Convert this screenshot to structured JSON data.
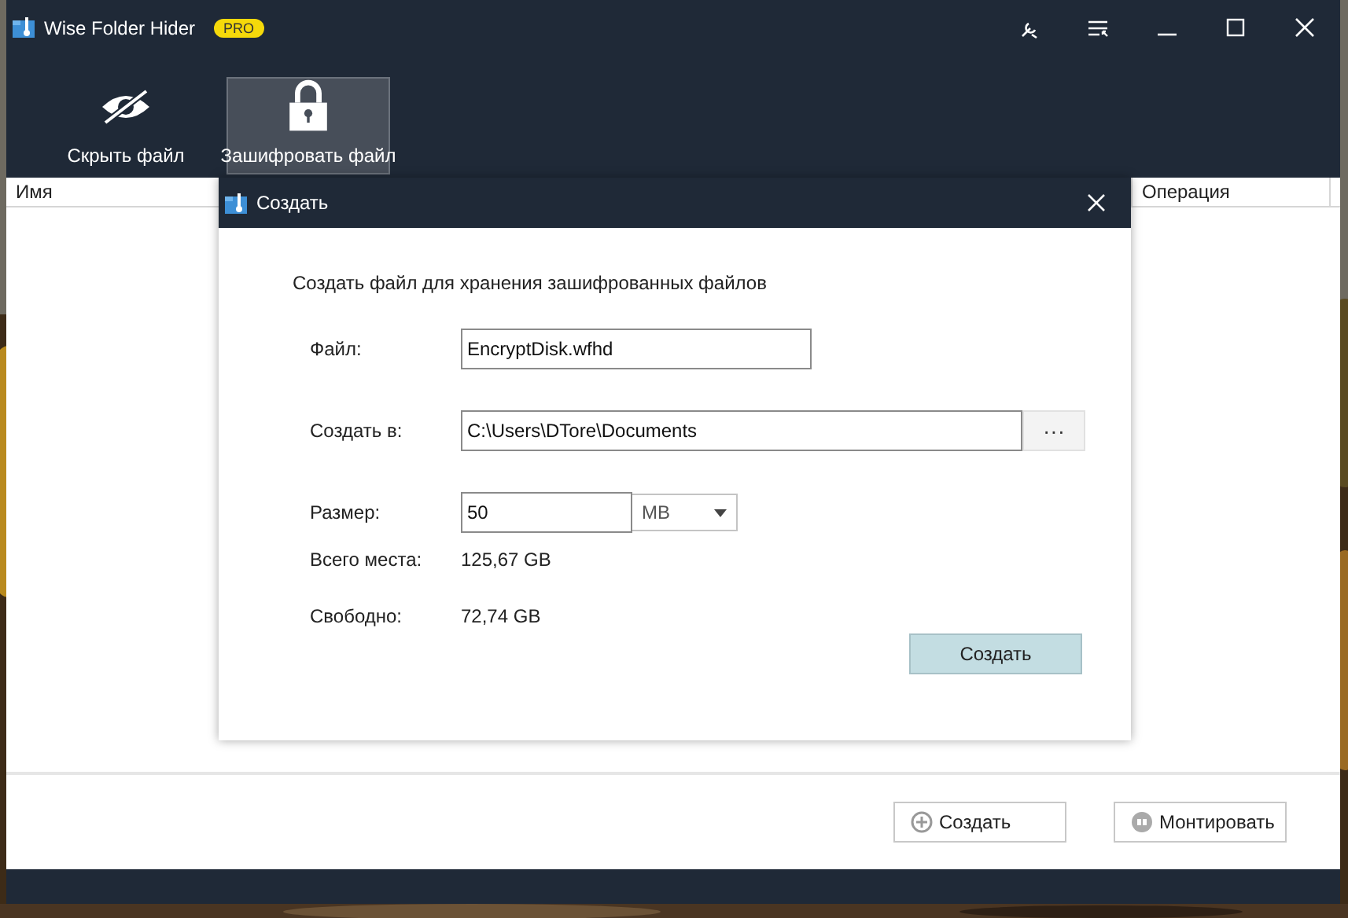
{
  "window": {
    "title": "Wise Folder Hider",
    "badge": "PRO"
  },
  "toolbar": [
    {
      "label": "Скрыть файл",
      "kind": "eye-off",
      "selected": false
    },
    {
      "label": "Зашифровать файл",
      "kind": "lock",
      "selected": true
    }
  ],
  "table": {
    "columns": [
      "Имя",
      "Операция"
    ]
  },
  "dialog": {
    "title": "Создать",
    "description": "Создать файл для хранения зашифрованных файлов",
    "fields": [
      {
        "kind": "text",
        "label": "Файл:",
        "value": "EncryptDisk.wfhd"
      },
      {
        "kind": "path",
        "label": "Создать в:",
        "value": "C:\\Users\\DTore\\Documents",
        "browse": "···"
      },
      {
        "kind": "size",
        "label": "Размер:",
        "value": "50",
        "unit": "MB"
      },
      {
        "kind": "info",
        "label": "Всего места:",
        "value": "125,67 GB"
      },
      {
        "kind": "info",
        "label": "Свободно:",
        "value": "72,74 GB"
      }
    ],
    "button": "Создать"
  },
  "actions": [
    {
      "label": "Создать",
      "kind": "plus"
    },
    {
      "label": "Монтировать",
      "kind": "mount"
    }
  ]
}
